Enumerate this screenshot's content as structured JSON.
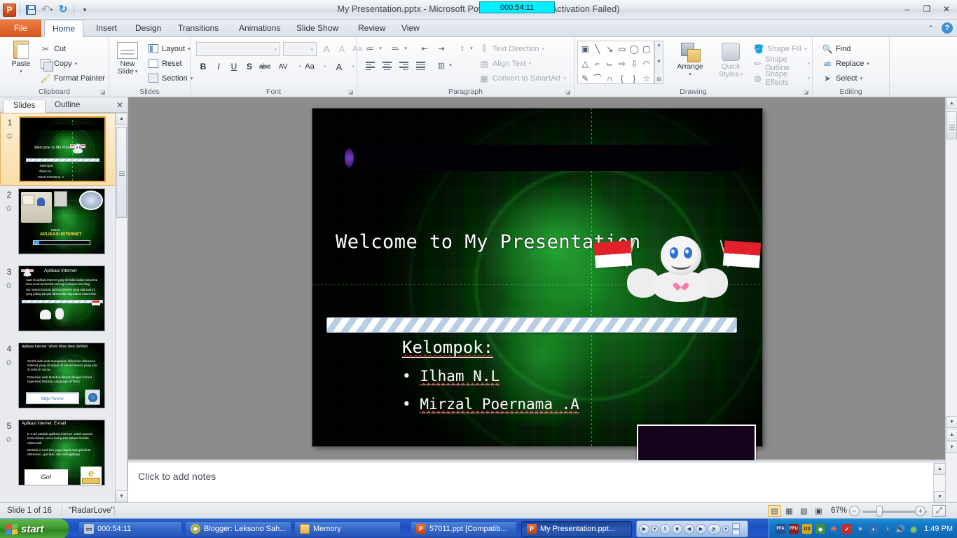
{
  "window": {
    "title": "My Presentation.pptx  -  Microsoft PowerPoint (Product Activation Failed)",
    "timer_overlay": "000:54:11",
    "minimize": "–",
    "restore": "❐",
    "close": "✕",
    "help": "?",
    "ribbon_collapse": "⌃"
  },
  "quick_access": {
    "app_letter": "P",
    "save": "save-icon",
    "undo": "↶",
    "redo": "↻",
    "customize": "▾"
  },
  "tabs": [
    {
      "label": "File",
      "active": false
    },
    {
      "label": "Home",
      "active": true
    },
    {
      "label": "Insert",
      "active": false
    },
    {
      "label": "Design",
      "active": false
    },
    {
      "label": "Transitions",
      "active": false
    },
    {
      "label": "Animations",
      "active": false
    },
    {
      "label": "Slide Show",
      "active": false
    },
    {
      "label": "Review",
      "active": false
    },
    {
      "label": "View",
      "active": false
    }
  ],
  "ribbon": {
    "groups": [
      {
        "name": "Clipboard"
      },
      {
        "name": "Slides"
      },
      {
        "name": "Font"
      },
      {
        "name": "Paragraph"
      },
      {
        "name": "Drawing"
      },
      {
        "name": "Editing"
      }
    ],
    "clipboard": {
      "paste": "Paste",
      "cut": "Cut",
      "copy": "Copy",
      "format_painter": "Format Painter"
    },
    "slides": {
      "new_slide": "New\nSlide",
      "new_slide_line1": "New",
      "new_slide_line2": "Slide",
      "layout": "Layout",
      "reset": "Reset",
      "section": "Section"
    },
    "font": {
      "font_name": "",
      "font_size": "",
      "grow": "A",
      "shrink": "A",
      "clear_formatting": "Aa",
      "bold": "B",
      "italic": "I",
      "underline": "U",
      "shadow": "S",
      "strikethrough": "abc",
      "character_spacing": "AV",
      "change_case": "Aa",
      "font_color": "A"
    },
    "paragraph": {
      "text_direction": "Text Direction",
      "align_text": "Align Text",
      "convert_smartart": "Convert to SmartArt"
    },
    "drawing": {
      "arrange": "Arrange",
      "quick_styles_line1": "Quick",
      "quick_styles_line2": "Styles",
      "shape_fill": "Shape Fill",
      "shape_outline": "Shape Outline",
      "shape_effects": "Shape Effects"
    },
    "editing": {
      "find": "Find",
      "replace": "Replace",
      "select": "Select"
    }
  },
  "left_pane": {
    "tab_slides": "Slides",
    "tab_outline": "Outline",
    "close": "✕",
    "slides": [
      {
        "number": "1",
        "selected": true,
        "title": "Welcome to My Presentation",
        "lines": [
          "Kelompok",
          "-Ilham  N.L",
          "-Mirzal Poernama  .A"
        ]
      },
      {
        "number": "2",
        "selected": false,
        "caption": "Materi",
        "title": "APLIKASI INTERNET",
        "lines": []
      },
      {
        "number": "3",
        "selected": false,
        "title": "Aplikasi Internet",
        "lines": [
          "Saat ini aplikasi internet yang tersedia sudah banyak & akan terus bertambah seiring kemajuan teknologi",
          "Dari sekian banyak aplikasi internet yang ada saat ini yang paling banyak dikenal dan digunakan antara lain :"
        ]
      },
      {
        "number": "4",
        "selected": false,
        "title": "Aplikasi Internet: World Wide Web (WWW)",
        "lines": [
          "World wide web merupakan dokumen-dokumen internet yang disimpan di server-server yang ada di seluruh dunia.",
          "Dokumen web tersebut dibuat dengan format Hypertext Markup Language (HTML)"
        ],
        "image_label": "http://www"
      },
      {
        "number": "5",
        "selected": false,
        "title": "Aplikasi Internet: E-mail",
        "lines": [
          "E-mail adalah aplikasi internet untuk sarana komunikasi surat-menyurat dalam bentuk elektronik",
          "Melalui e-mail  kita juga dapat mengirimkan dokumen, gambar, dan sebagainya"
        ],
        "image_label": "Go!"
      }
    ]
  },
  "slide": {
    "title": "Welcome to My Presentation",
    "heading": "Kelompok:",
    "bullets": [
      {
        "marker": "•",
        "text": "Ilham N.L"
      },
      {
        "marker": "•",
        "text": "Mirzal Poernama .A"
      }
    ]
  },
  "notes": {
    "placeholder": "Click to add notes"
  },
  "status_bar": {
    "slide_counter": "Slide 1 of 16",
    "theme_name": "\"RadarLove\"",
    "zoom_level": "67%",
    "zoom_out": "−",
    "zoom_in": "+",
    "fit_to_window": "fit-slide-icon",
    "views": [
      {
        "name": "normal-view",
        "glyph": "▤",
        "selected": true
      },
      {
        "name": "slide-sorter-view",
        "glyph": "▦",
        "selected": false
      },
      {
        "name": "reading-view",
        "glyph": "▧",
        "selected": false
      },
      {
        "name": "slide-show-view",
        "glyph": "▣",
        "selected": false
      }
    ]
  },
  "taskbar": {
    "start": "start",
    "buttons": [
      {
        "label": "000:54:11",
        "icon": "monitor-icon",
        "active": false
      },
      {
        "label": "Blogger: Leksono Sah...",
        "icon": "chrome-icon",
        "active": false
      },
      {
        "label": "Memory",
        "icon": "folder-icon",
        "active": false
      },
      {
        "label": "57011.ppt [Compatib...",
        "icon": "powerpoint-icon",
        "active": false
      },
      {
        "label": "My Presentation.ppt...",
        "icon": "powerpoint-icon",
        "active": true
      }
    ],
    "media_controls": [
      {
        "name": "wmp-logo-button",
        "glyph": "▶"
      },
      {
        "name": "wmp-menu-button",
        "glyph": "▾"
      },
      {
        "name": "pause-button",
        "glyph": "‖"
      },
      {
        "name": "stop-button",
        "glyph": "■"
      },
      {
        "name": "previous-button",
        "glyph": "◀"
      },
      {
        "name": "next-button",
        "glyph": "▶"
      },
      {
        "name": "mute-button",
        "glyph": "🔈"
      },
      {
        "name": "volume-dropdown-button",
        "glyph": "▾"
      }
    ],
    "tray_icons": [
      {
        "name": "ffa-icon",
        "label": "FFA",
        "color": "#27508c"
      },
      {
        "name": "ffu-icon",
        "label": "FFU",
        "color": "#8c1f1f"
      },
      {
        "name": "u3-icon",
        "label": "U3",
        "color": "#d8a520"
      },
      {
        "name": "green-shield-icon",
        "label": "◆",
        "color": "#3f8f3f"
      },
      {
        "name": "red-sun-icon",
        "label": "☀",
        "color": "#c23b2c"
      },
      {
        "name": "avira-icon",
        "label": "✓",
        "color": "#c2302a"
      },
      {
        "name": "grey-disc-icon",
        "label": "●",
        "color": "#8e8e8e"
      },
      {
        "name": "blue-swirl-icon",
        "label": "◐",
        "color": "#2a6fb8"
      },
      {
        "name": "orange-swirl-icon",
        "label": "◑",
        "color": "#d46a1d"
      },
      {
        "name": "speaker-icon",
        "label": "🔊",
        "color": "#c45a1d"
      },
      {
        "name": "nvidia-icon",
        "label": "◉",
        "color": "#5aa234"
      }
    ],
    "clock": "1:49 PM"
  }
}
